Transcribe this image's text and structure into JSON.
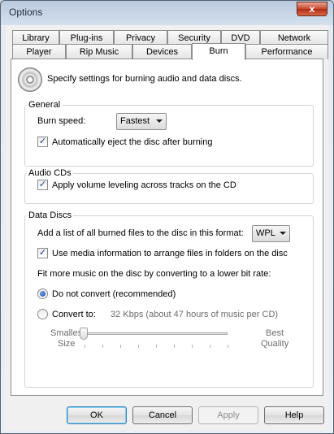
{
  "window": {
    "title": "Options",
    "close_symbol": "x"
  },
  "tabs_row1": [
    "Library",
    "Plug-ins",
    "Privacy",
    "Security",
    "DVD",
    "Network"
  ],
  "tabs_row2": [
    "Player",
    "Rip Music",
    "Devices",
    "Burn",
    "Performance"
  ],
  "active_tab": "Burn",
  "description": "Specify settings for burning audio and data discs.",
  "general": {
    "label": "General",
    "burn_speed_label": "Burn speed:",
    "burn_speed_value": "Fastest",
    "auto_eject_label": "Automatically eject the disc after burning",
    "auto_eject_checked": true
  },
  "audio_cds": {
    "label": "Audio CDs",
    "volume_leveling_label": "Apply volume leveling across tracks on the CD",
    "volume_leveling_checked": true
  },
  "data_discs": {
    "label": "Data Discs",
    "list_format_label": "Add a list of all burned files to the disc in this format:",
    "list_format_value": "WPL",
    "media_info_label": "Use media information to arrange files in folders on the disc",
    "media_info_checked": true,
    "fit_more_label": "Fit more music on the disc by converting to a lower bit rate:",
    "do_not_convert_label": "Do not convert (recommended)",
    "convert_to_label": "Convert to:",
    "convert_info": "32 Kbps (about 47 hours of music per CD)",
    "selected_option": "Do not convert (recommended)",
    "slider_left_label_1": "Smallest",
    "slider_left_label_2": "Size",
    "slider_right_label_1": "Best",
    "slider_right_label_2": "Quality",
    "slider_position": 0
  },
  "buttons": {
    "ok": "OK",
    "cancel": "Cancel",
    "apply": "Apply",
    "help": "Help"
  },
  "colors": {
    "accent": "#3c7fb1",
    "close_red": "#c8472c"
  }
}
